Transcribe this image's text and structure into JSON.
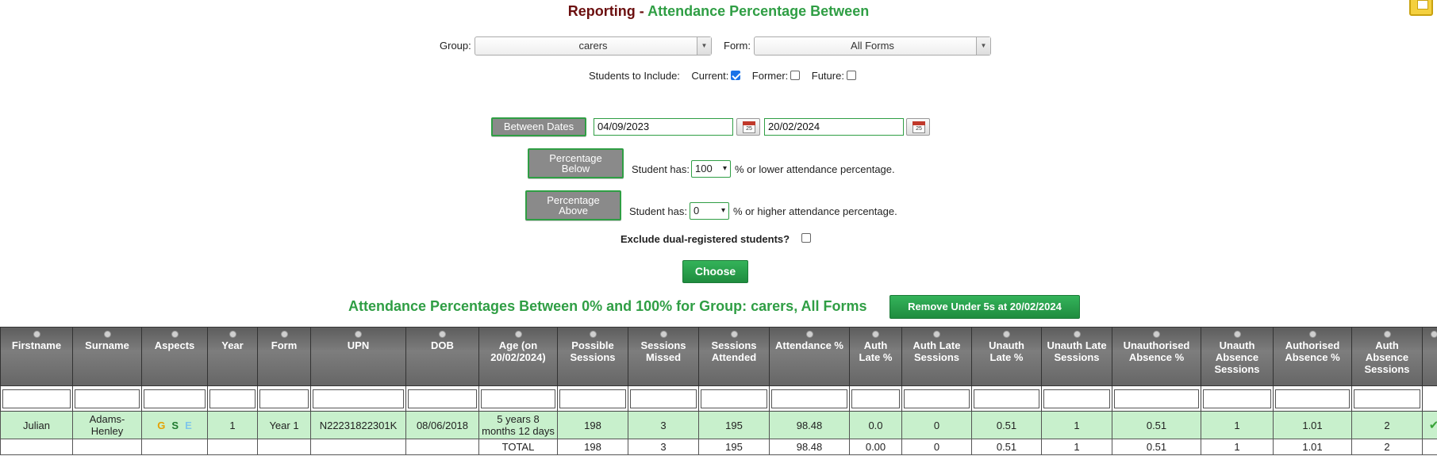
{
  "page": {
    "title_prefix": "Reporting - ",
    "title_main": "Attendance Percentage Between"
  },
  "filters": {
    "group_label": "Group:",
    "group_value": "carers",
    "form_label": "Form:",
    "form_value": "All Forms",
    "students_label": "Students to Include:",
    "current_label": "Current:",
    "current_checked": true,
    "former_label": "Former:",
    "former_checked": false,
    "future_label": "Future:",
    "future_checked": false
  },
  "dates": {
    "button_label": "Between Dates",
    "start": "04/09/2023",
    "end": "20/02/2024",
    "calendar_day": "25"
  },
  "below": {
    "button_line1": "Percentage",
    "button_line2": "Below",
    "prefix": "Student has:",
    "value": "100",
    "suffix": "% or lower attendance percentage."
  },
  "above": {
    "button_line1": "Percentage",
    "button_line2": "Above",
    "prefix": "Student has:",
    "value": "0",
    "suffix": "% or higher attendance percentage."
  },
  "exclude_label": "Exclude dual-registered students?",
  "choose_label": "Choose",
  "results_title": "Attendance Percentages Between 0% and 100% for Group: carers, All Forms",
  "remove_button": "Remove Under 5s at 20/02/2024",
  "table": {
    "headers": [
      [
        "Firstname"
      ],
      [
        "Surname"
      ],
      [
        "Aspects"
      ],
      [
        "Year"
      ],
      [
        "Form"
      ],
      [
        "UPN"
      ],
      [
        "DOB"
      ],
      [
        "Age (on",
        "20/02/2024)"
      ],
      [
        "Possible",
        "Sessions"
      ],
      [
        "Sessions",
        "Missed"
      ],
      [
        "Sessions",
        "Attended"
      ],
      [
        "Attendance %"
      ],
      [
        "Auth",
        "Late %"
      ],
      [
        "Auth Late",
        "Sessions"
      ],
      [
        "Unauth",
        "Late %"
      ],
      [
        "Unauth Late",
        "Sessions"
      ],
      [
        "Unauthorised",
        "Absence %"
      ],
      [
        "Unauth",
        "Absence",
        "Sessions"
      ],
      [
        "Authorised",
        "Absence %"
      ],
      [
        "Auth",
        "Absence",
        "Sessions"
      ],
      [
        ""
      ]
    ],
    "row": {
      "firstname": "Julian",
      "surname_1": "Adams-",
      "surname_2": "Henley",
      "aspect_g": "G",
      "aspect_s": "S",
      "aspect_e": "E",
      "year": "1",
      "form": "Year 1",
      "upn": "N22231822301K",
      "dob": "08/06/2018",
      "age_1": "5 years 8",
      "age_2": "months 12 days",
      "possible": "198",
      "missed": "3",
      "attended": "195",
      "attendance_pct": "98.48",
      "auth_late_pct": "0.0",
      "auth_late_sessions": "0",
      "unauth_late_pct": "0.51",
      "unauth_late_sessions": "1",
      "unauth_absence_pct": "0.51",
      "unauth_absence_sessions": "1",
      "auth_absence_pct": "1.01",
      "auth_absence_sessions": "2",
      "tick": "✔"
    },
    "total": {
      "label": "TOTAL",
      "possible": "198",
      "missed": "3",
      "attended": "195",
      "attendance_pct": "98.48",
      "auth_late_pct": "0.00",
      "auth_late_sessions": "0",
      "unauth_late_pct": "0.51",
      "unauth_late_sessions": "1",
      "unauth_absence_pct": "0.51",
      "unauth_absence_sessions": "1",
      "auth_absence_pct": "1.01",
      "auth_absence_sessions": "2"
    }
  }
}
